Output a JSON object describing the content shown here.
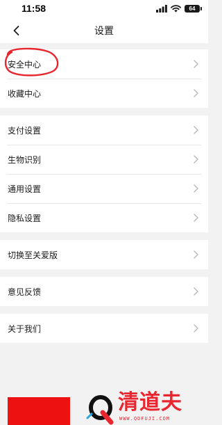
{
  "status_bar": {
    "time": "11:58",
    "battery": "64",
    "icons": [
      "cellular-signal-icon",
      "wifi-icon",
      "battery-icon"
    ]
  },
  "nav": {
    "back_icon": "chevron-left-icon",
    "title": "设置"
  },
  "groups": [
    {
      "items": [
        {
          "label": "安全中心"
        },
        {
          "label": "收藏中心"
        }
      ]
    },
    {
      "items": [
        {
          "label": "支付设置"
        },
        {
          "label": "生物识别"
        },
        {
          "label": "通用设置"
        },
        {
          "label": "隐私设置"
        }
      ]
    },
    {
      "items": [
        {
          "label": "切换至关爱版"
        }
      ]
    },
    {
      "items": [
        {
          "label": "意见反馈"
        }
      ]
    },
    {
      "items": [
        {
          "label": "关于我们"
        }
      ]
    }
  ],
  "row_icon": "chevron-right-icon",
  "annotation": {
    "type": "red-hand-drawn-circle",
    "target": "安全中心"
  },
  "watermark": {
    "name": "清道夫",
    "url": "WWW.QDFUJI.COM",
    "logo_icon": "q-logo-icon"
  },
  "colors": {
    "background": "#f2f2f2",
    "card": "#ffffff",
    "divider": "#e6e6e6",
    "chevron": "#b5b5b5",
    "annotation": "#e8262f",
    "watermark": "#e8262f",
    "footer_block": "#ee1111"
  }
}
